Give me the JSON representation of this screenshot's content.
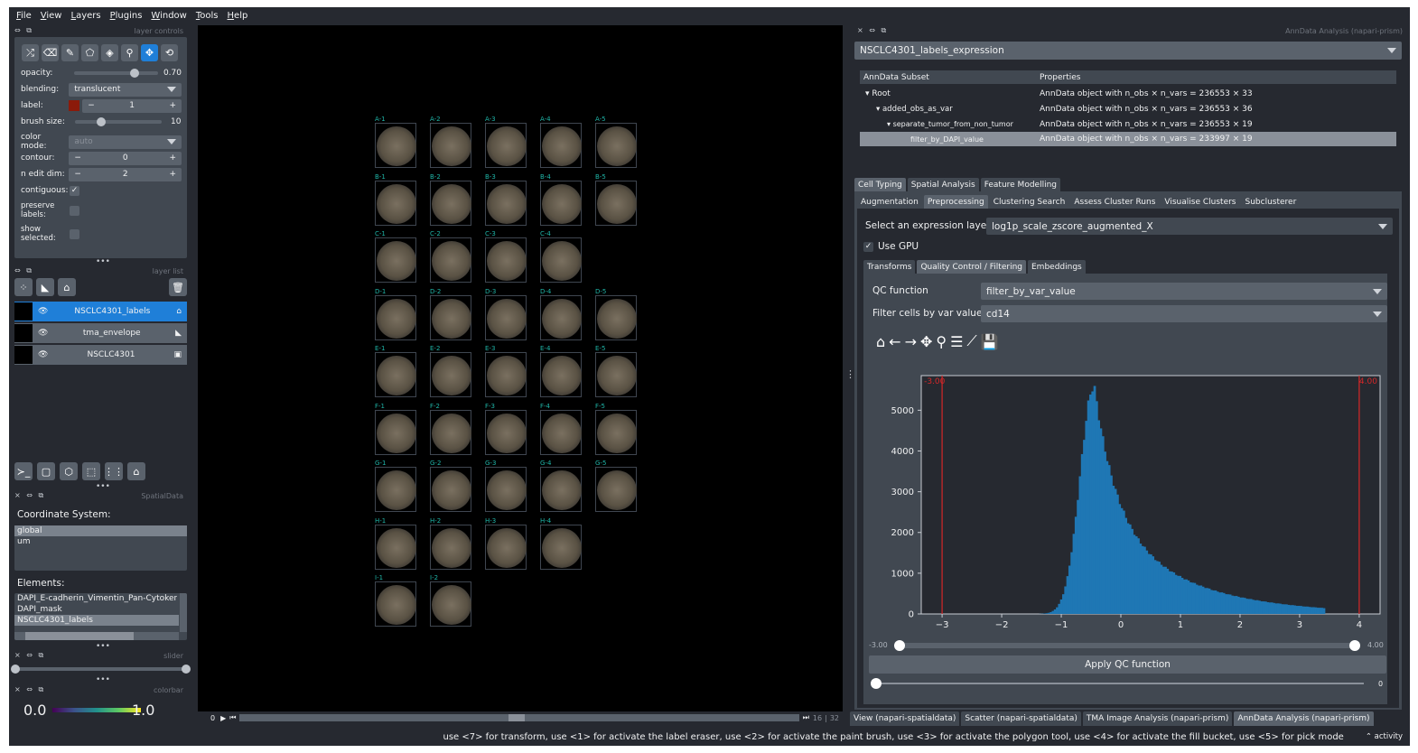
{
  "menu": [
    "File",
    "View",
    "Layers",
    "Plugins",
    "Window",
    "Tools",
    "Help"
  ],
  "layer_controls": {
    "title": "layer controls",
    "opacity_label": "opacity:",
    "opacity_value": "0.70",
    "opacity_frac": 0.7,
    "blending_label": "blending:",
    "blending_value": "translucent",
    "label_label": "label:",
    "label_value": "1",
    "label_color": "#8b1a0a",
    "brush_label": "brush size:",
    "brush_value": "10",
    "brush_frac": 0.3,
    "colormode_label": "color mode:",
    "colormode_value": "auto",
    "contour_label": "contour:",
    "contour_value": "0",
    "nedit_label": "n edit dim:",
    "nedit_value": "2",
    "contig_label": "contiguous:",
    "preserve_label": "preserve labels:",
    "show_label": "show selected:"
  },
  "layer_list": {
    "title": "layer list",
    "layers": [
      {
        "name": "NSCLC4301_labels",
        "selected": true
      },
      {
        "name": "tma_envelope",
        "selected": false
      },
      {
        "name": "NSCLC4301",
        "selected": false
      }
    ]
  },
  "spatialdata": {
    "title": "SpatialData",
    "coord_label": "Coordinate System:",
    "coords": [
      "global",
      "um"
    ],
    "elements_label": "Elements:",
    "elements": [
      "DAPI_E-cadherin_Vimentin_Pan-Cytokerati",
      "DAPI_mask",
      "NSCLC4301_labels"
    ]
  },
  "slider_title": "slider",
  "colorbar_title": "colorbar",
  "colorbar_min": "0.0",
  "colorbar_max": "1.0",
  "canvas": {
    "rows": [
      [
        "A-1",
        "A-2",
        "A-3",
        "A-4",
        "A-5"
      ],
      [
        "B-1",
        "B-2",
        "B-3",
        "B-4",
        "B-5"
      ],
      [
        "C-1",
        "C-2",
        "C-3",
        "C-4"
      ],
      [
        "D-1",
        "D-2",
        "D-3",
        "D-4",
        "D-5"
      ],
      [
        "E-1",
        "E-2",
        "E-3",
        "E-4",
        "E-5"
      ],
      [
        "F-1",
        "F-2",
        "F-3",
        "F-4",
        "F-5"
      ],
      [
        "G-1",
        "G-2",
        "G-3",
        "G-4",
        "G-5"
      ],
      [
        "H-1",
        "H-2",
        "H-3",
        "H-4"
      ],
      [
        "I-1",
        "I-2"
      ]
    ],
    "frame_start": "0",
    "frame_cur": "16",
    "frame_total": "32"
  },
  "right": {
    "title": "AnnData Analysis (napari-prism)",
    "dataset": "NSCLC4301_labels_expression",
    "tree_headers": [
      "AnnData Subset",
      "Properties"
    ],
    "tree": [
      {
        "name": "Root",
        "props": "AnnData object with n_obs × n_vars = 236553 × 33"
      },
      {
        "name": "added_obs_as_var",
        "props": "AnnData object with n_obs × n_vars = 236553 × 36"
      },
      {
        "name": "separate_tumor_from_non_tumor",
        "props": "AnnData object with n_obs × n_vars = 236553 × 19"
      },
      {
        "name": "filter_by_DAPI_value",
        "props": "AnnData object with n_obs × n_vars = 233997 × 19"
      }
    ],
    "tabs1": [
      "Cell Typing",
      "Spatial Analysis",
      "Feature Modelling"
    ],
    "tabs2": [
      "Augmentation",
      "Preprocessing",
      "Clustering Search",
      "Assess Cluster Runs",
      "Visualise Clusters",
      "Subclusterer"
    ],
    "expr_label": "Select an expression layer",
    "expr_value": "log1p_scale_zscore_augmented_X",
    "gpu_label": "Use GPU",
    "tabs3": [
      "Transforms",
      "Quality Control / Filtering",
      "Embeddings"
    ],
    "qc_label": "QC function",
    "qc_value": "filter_by_var_value",
    "filter_label": "Filter cells by var values",
    "filter_value": "cd14",
    "range_min": "-3.00",
    "range_max": "4.00",
    "apply": "Apply QC function",
    "bottom_slider_val": "0"
  },
  "chart_data": {
    "type": "bar",
    "xlim": [
      -3.35,
      4.35
    ],
    "ylim": [
      0,
      5850
    ],
    "xticks": [
      -3,
      -2,
      -1,
      0,
      1,
      2,
      3,
      4
    ],
    "yticks": [
      0,
      1000,
      2000,
      3000,
      4000,
      5000
    ],
    "threshold_lines": [
      -3,
      4
    ],
    "threshold_labels": [
      "-3.00",
      "4.00"
    ],
    "peak": {
      "x": -0.45,
      "y": 5600
    },
    "color": "#1f77b4",
    "line_color": "#d62728"
  },
  "bottom_tabs": [
    "View (napari-spatialdata)",
    "Scatter (napari-spatialdata)",
    "TMA Image Analysis (napari-prism)",
    "AnnData Analysis (napari-prism)"
  ],
  "status": "use <7> for transform, use <1> for activate the label eraser, use <2> for activate the paint brush, use <3> for activate the polygon tool, use <4> for activate the fill bucket, use <5> for pick mode",
  "activity": "activity"
}
